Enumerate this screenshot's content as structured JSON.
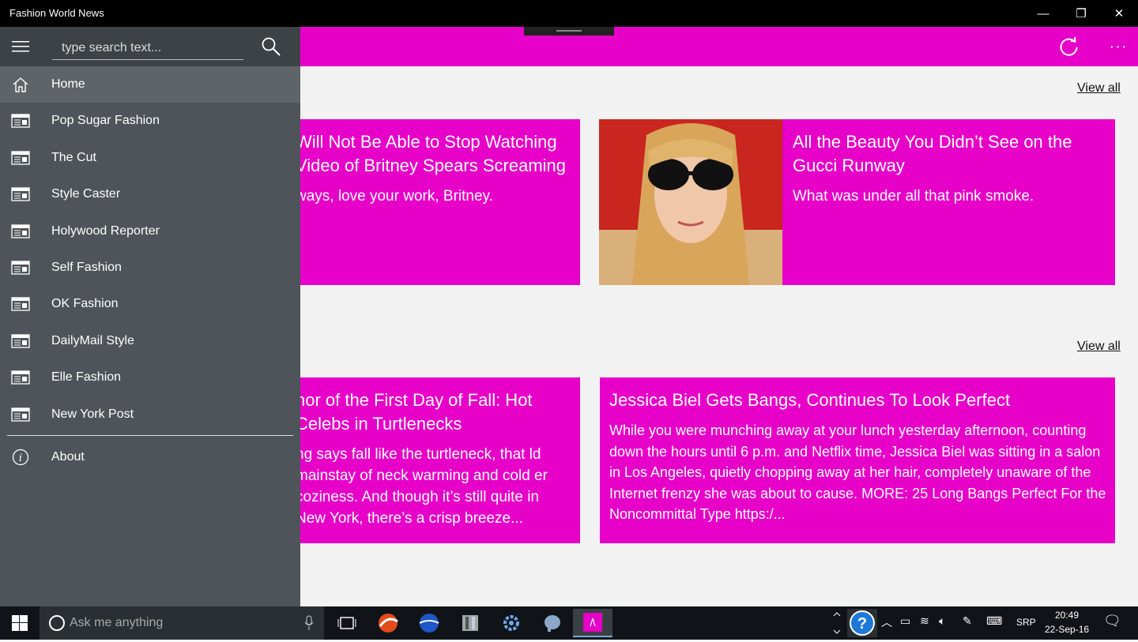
{
  "window": {
    "title": "Fashion World News",
    "minimize_glyph": "—",
    "restore_glyph": "❐",
    "close_glyph": "✕"
  },
  "appbar": {
    "color": "#e600c8",
    "refresh_icon": "refresh-icon",
    "more_glyph": "···"
  },
  "sidebar": {
    "search": {
      "placeholder": "type search text..."
    },
    "items": [
      {
        "label": "Home",
        "icon": "home-icon",
        "active": true
      },
      {
        "label": "Pop Sugar Fashion",
        "icon": "news-icon"
      },
      {
        "label": "The Cut",
        "icon": "news-icon"
      },
      {
        "label": "Style Caster",
        "icon": "news-icon"
      },
      {
        "label": "Holywood Reporter",
        "icon": "news-icon"
      },
      {
        "label": "Self Fashion",
        "icon": "news-icon"
      },
      {
        "label": "OK Fashion",
        "icon": "news-icon"
      },
      {
        "label": "DailyMail Style",
        "icon": "news-icon"
      },
      {
        "label": "Elle Fashion",
        "icon": "news-icon"
      },
      {
        "label": "New York Post",
        "icon": "news-icon"
      }
    ],
    "about": {
      "label": "About",
      "icon": "info-icon"
    }
  },
  "sections": [
    {
      "view_all": "View all",
      "cards": [
        {
          "title": "Will Not Be Able to Stop Watching Video of Britney Spears Screaming",
          "description": "ways, love your work, Britney."
        },
        {
          "title": "All the Beauty You Didn’t See on the Gucci Runway",
          "description": "What was under all that pink smoke."
        }
      ]
    },
    {
      "view_all": "View all",
      "cards": [
        {
          "title": "nor of the First Day of Fall: Hot Celebs in Turtlenecks",
          "description": "ng says fall like the turtleneck, that ld mainstay of neck warming and cold er coziness. And though it’s still quite in New York, there’s a crisp breeze..."
        },
        {
          "title": "Jessica Biel Gets Bangs, Continues To Look Perfect",
          "description": "While you were munching away at your lunch yesterday afternoon, counting down the hours until 6 p.m. and Netflix time, Jessica Biel was sitting in a salon in Los Angeles, quietly chopping away at her hair, completely unaware of the Internet frenzy she was about to cause. MORE: 25 Long Bangs Perfect For the Noncommittal Type https:/..."
        }
      ]
    }
  ],
  "taskbar": {
    "cortana_placeholder": "Ask me anything",
    "language": "SRP",
    "time": "20:49",
    "date": "22-Sep-16"
  }
}
